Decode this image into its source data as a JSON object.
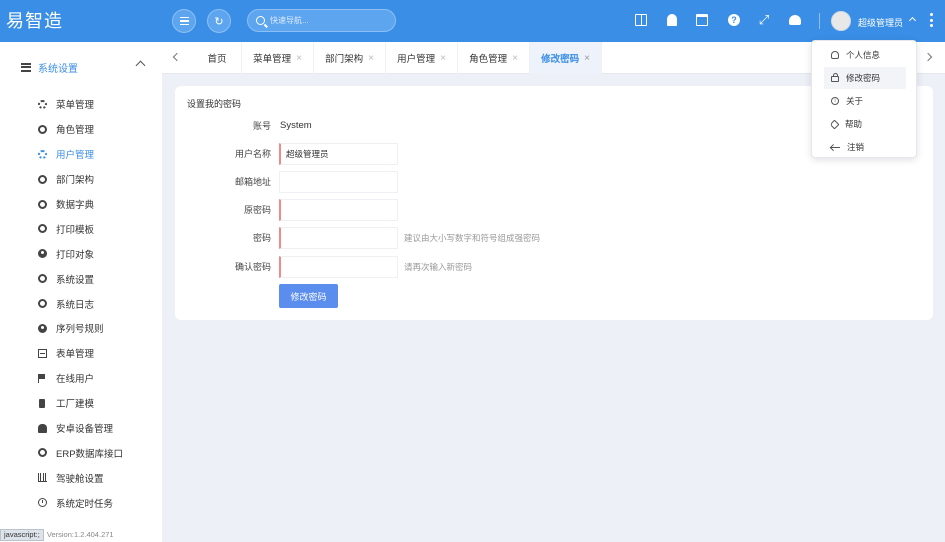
{
  "app": {
    "title": "易智造"
  },
  "header": {
    "search_placeholder": "快速导航...",
    "user_name": "超级管理员",
    "icons": [
      "menu-icon",
      "refresh-icon",
      "board-icon",
      "bell-icon",
      "calendar-icon",
      "help-icon",
      "fullscreen-icon",
      "dashboard-icon",
      "more-icon"
    ],
    "accent_color": "#3a8ee6"
  },
  "sidebar": {
    "group_label": "系统设置",
    "items": [
      {
        "label": "菜单管理",
        "icon": "gear-icon"
      },
      {
        "label": "角色管理",
        "icon": "ring-icon"
      },
      {
        "label": "用户管理",
        "icon": "gear-icon",
        "active": true
      },
      {
        "label": "部门架构",
        "icon": "ring-icon"
      },
      {
        "label": "数据字典",
        "icon": "ring-icon"
      },
      {
        "label": "打印模板",
        "icon": "ring-icon"
      },
      {
        "label": "打印对象",
        "icon": "compass-icon"
      },
      {
        "label": "系统设置",
        "icon": "ring-icon"
      },
      {
        "label": "系统日志",
        "icon": "ring-icon"
      },
      {
        "label": "序列号规则",
        "icon": "compass-icon"
      },
      {
        "label": "表单管理",
        "icon": "form-icon"
      },
      {
        "label": "在线用户",
        "icon": "flag-icon"
      },
      {
        "label": "工厂建模",
        "icon": "phone-icon"
      },
      {
        "label": "安卓设备管理",
        "icon": "android-icon"
      },
      {
        "label": "ERP数据库接口",
        "icon": "ring-icon"
      },
      {
        "label": "驾驶舱设置",
        "icon": "bar-chart-icon"
      },
      {
        "label": "系统定时任务",
        "icon": "clock-icon"
      }
    ]
  },
  "status": {
    "js": "javascript:;",
    "version": "Version:1.2.404.271"
  },
  "tabs": [
    {
      "label": "首页",
      "closable": false
    },
    {
      "label": "菜单管理",
      "closable": true
    },
    {
      "label": "部门架构",
      "closable": true
    },
    {
      "label": "用户管理",
      "closable": true
    },
    {
      "label": "角色管理",
      "closable": true
    },
    {
      "label": "修改密码",
      "closable": true,
      "active": true
    }
  ],
  "form": {
    "title": "设置我的密码",
    "account_label": "账号",
    "account_value": "System",
    "username_label": "用户名称",
    "username_value": "超级管理员",
    "email_label": "邮箱地址",
    "email_value": "",
    "old_password_label": "原密码",
    "password_label": "密码",
    "password_hint": "建议由大小写数字和符号组成强密码",
    "confirm_label": "确认密码",
    "confirm_hint": "请再次输入新密码",
    "submit_label": "修改密码"
  },
  "user_menu": [
    {
      "label": "个人信息",
      "icon": "user-icon"
    },
    {
      "label": "修改密码",
      "icon": "lock-icon",
      "hover": true
    },
    {
      "label": "关于",
      "icon": "info-icon"
    },
    {
      "label": "帮助",
      "icon": "tag-icon"
    },
    {
      "label": "注销",
      "icon": "back-arrow-icon"
    }
  ]
}
